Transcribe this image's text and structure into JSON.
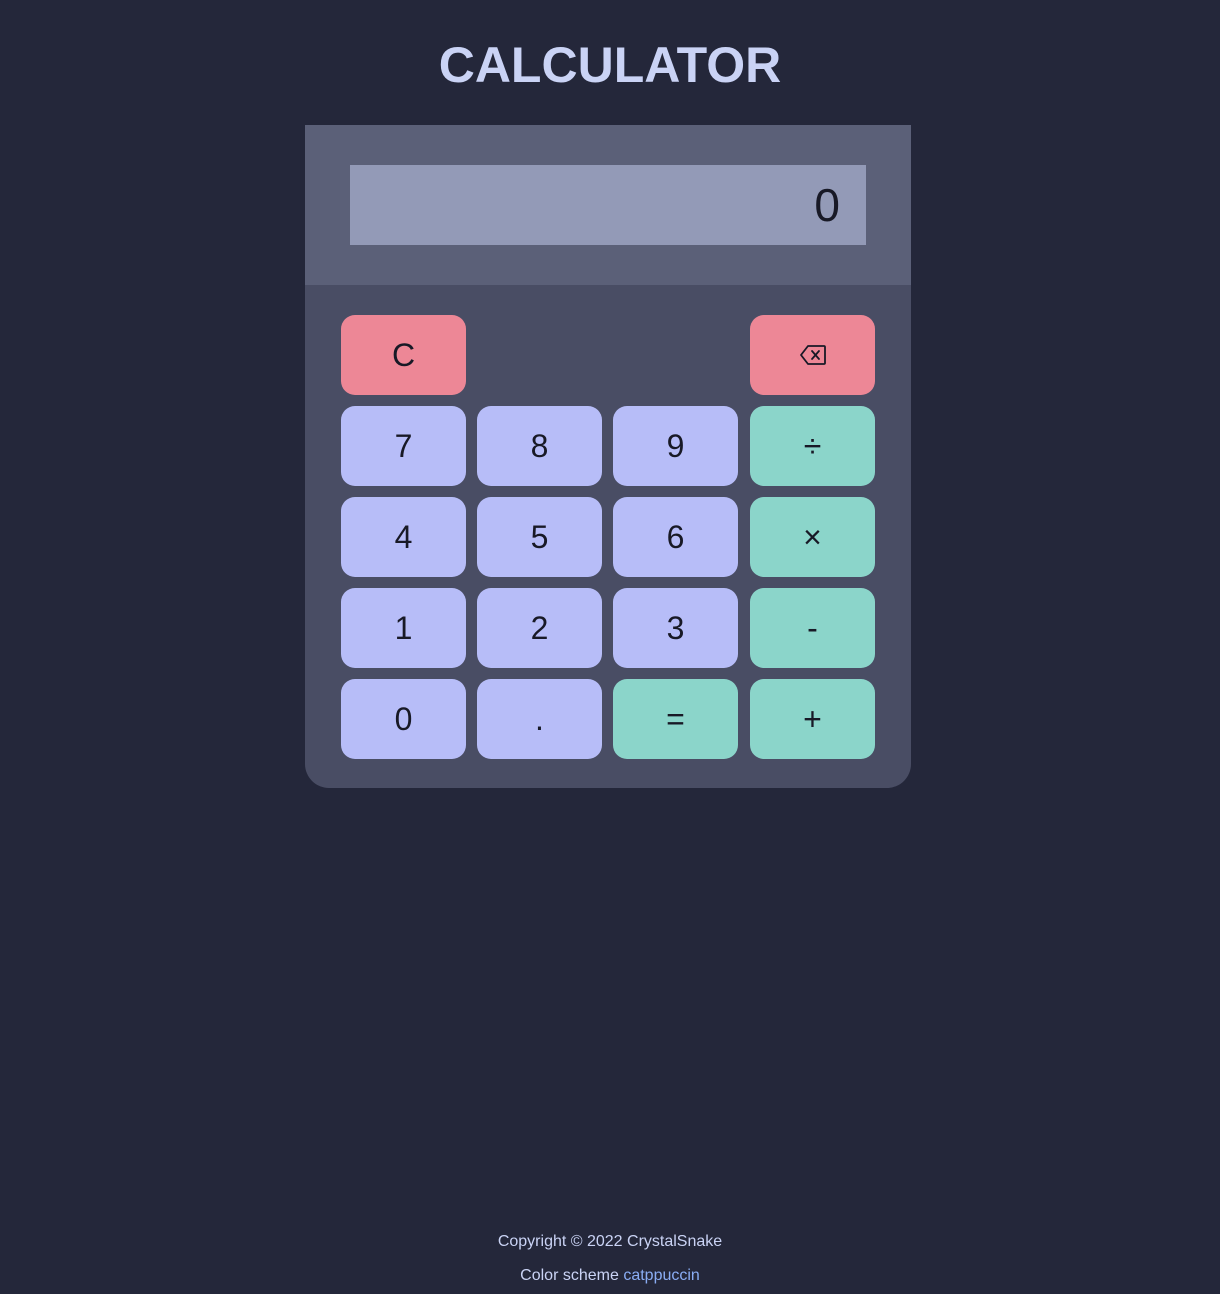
{
  "app": {
    "title": "CALCULATOR"
  },
  "display": {
    "value": "0"
  },
  "keypad": {
    "clear": "C",
    "backspace_icon": "backspace-icon",
    "seven": "7",
    "eight": "8",
    "nine": "9",
    "divide": "÷",
    "four": "4",
    "five": "5",
    "six": "6",
    "multiply": "×",
    "one": "1",
    "two": "2",
    "three": "3",
    "subtract": "-",
    "zero": "0",
    "decimal": ".",
    "equals": "=",
    "add": "+"
  },
  "footer": {
    "copyright": "Copyright © 2022 CrystalSnake",
    "color_scheme_label": "Color scheme",
    "color_scheme_link": "catppuccin"
  },
  "colors": {
    "background": "#24273a",
    "panel": "#494d64",
    "display_bezel": "#5b6078",
    "display": "#939ab7",
    "number_key": "#b7bdf8",
    "operator_key": "#8bd5ca",
    "clear_key": "#ed8796",
    "title": "#cad3f5",
    "link": "#8aadf4"
  }
}
